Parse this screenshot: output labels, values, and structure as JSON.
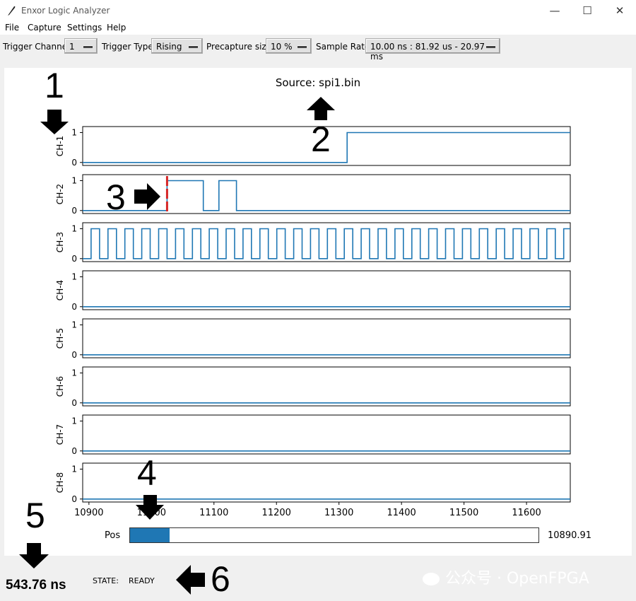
{
  "window": {
    "title": "Enxor Logic Analyzer",
    "minimize": "—",
    "maximize": "☐",
    "close": "✕"
  },
  "menu": [
    "File",
    "Capture",
    "Settings",
    "Help"
  ],
  "toolbar": {
    "trigger_channel_label": "Trigger Channel",
    "trigger_channel_value": "1",
    "trigger_type_label": "Trigger Type",
    "trigger_type_value": "Rising",
    "precapture_label": "Precapture size",
    "precapture_value": "10 %",
    "sample_rate_label": "Sample Rate",
    "sample_rate_value": "10.00 ns : 81.92 us - 20.97 ms"
  },
  "chart_data": {
    "type": "line",
    "title": "Source: spi1.bin",
    "x_ticks": [
      10900,
      11000,
      11100,
      11200,
      11300,
      11400,
      11500,
      11600
    ],
    "xlim": [
      10890,
      11670
    ],
    "ylim": [
      -0.1,
      1.2
    ],
    "y_ticks": [
      0,
      1
    ],
    "trigger_marker_x": 11025,
    "channels": [
      {
        "name": "CH-1",
        "steps": [
          [
            10890,
            0
          ],
          [
            11313,
            1
          ],
          [
            11670,
            1
          ]
        ]
      },
      {
        "name": "CH-2",
        "steps": [
          [
            10890,
            0
          ],
          [
            11025,
            1
          ],
          [
            11083,
            0
          ],
          [
            11108,
            1
          ],
          [
            11136,
            0
          ],
          [
            11670,
            0
          ]
        ]
      },
      {
        "name": "CH-3",
        "clock": {
          "start": 10890,
          "period": 27,
          "high_first": false
        }
      },
      {
        "name": "CH-4",
        "steps": [
          [
            10890,
            0
          ],
          [
            11670,
            0
          ]
        ]
      },
      {
        "name": "CH-5",
        "steps": [
          [
            10890,
            0
          ],
          [
            11670,
            0
          ]
        ]
      },
      {
        "name": "CH-6",
        "steps": [
          [
            10890,
            0
          ],
          [
            11670,
            0
          ]
        ]
      },
      {
        "name": "CH-7",
        "steps": [
          [
            10890,
            0
          ],
          [
            11670,
            0
          ]
        ]
      },
      {
        "name": "CH-8",
        "steps": [
          [
            10890,
            0
          ],
          [
            11670,
            0
          ]
        ]
      }
    ],
    "line_color": "#1f77b4",
    "marker_color": "#d62728"
  },
  "position": {
    "label": "Pos",
    "value": "10890.91",
    "fill_fraction": 0.097
  },
  "status": {
    "time": "543.76 ns",
    "state_label": "STATE:",
    "state_value": "READY"
  },
  "annotations": [
    "1",
    "2",
    "3",
    "4",
    "5",
    "6"
  ],
  "watermark": "公众号 · OpenFPGA"
}
